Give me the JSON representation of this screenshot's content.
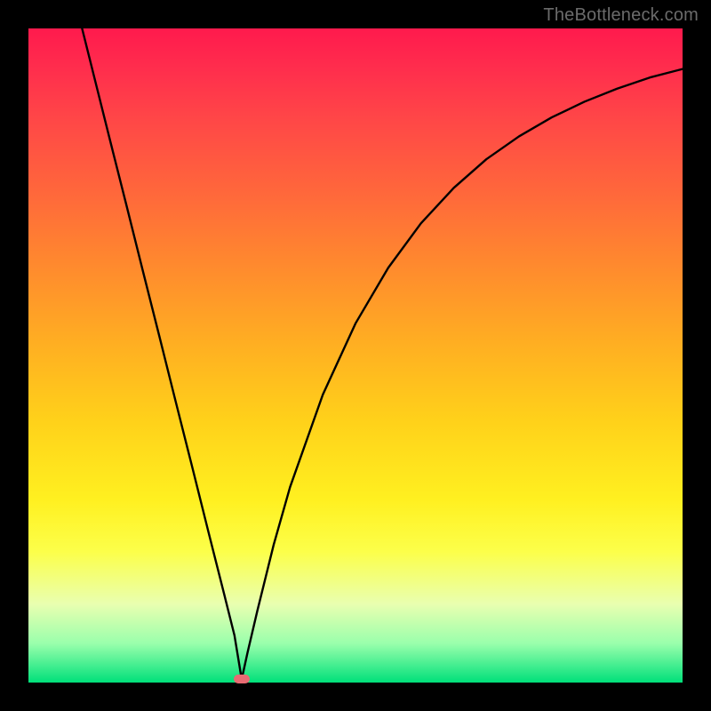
{
  "watermark": "TheBottleneck.com",
  "colors": {
    "frame": "#000000",
    "gradient_top": "#ff1a4d",
    "gradient_bottom": "#00e07a",
    "curve": "#000000",
    "marker": "#e86b73"
  },
  "chart_data": {
    "type": "line",
    "title": "",
    "xlabel": "",
    "ylabel": "",
    "xlim": [
      0,
      100
    ],
    "ylim": [
      0,
      100
    ],
    "x": [
      8.2,
      10,
      12.5,
      15,
      17.5,
      20,
      22.5,
      25,
      27.5,
      30,
      31.5,
      32.6,
      33.5,
      35,
      37.5,
      40,
      45,
      50,
      55,
      60,
      65,
      70,
      75,
      80,
      85,
      90,
      95,
      100
    ],
    "y": [
      100,
      92.8,
      82.8,
      72.9,
      62.9,
      53.0,
      43.0,
      33.1,
      23.1,
      13.2,
      7.2,
      0.5,
      4.6,
      11.0,
      21.1,
      29.9,
      44.0,
      54.9,
      63.4,
      70.2,
      75.6,
      80.0,
      83.5,
      86.4,
      88.8,
      90.8,
      92.5,
      93.8
    ],
    "minimum_point": {
      "x": 32.6,
      "y": 0.5
    },
    "grid": false,
    "legend": false
  }
}
